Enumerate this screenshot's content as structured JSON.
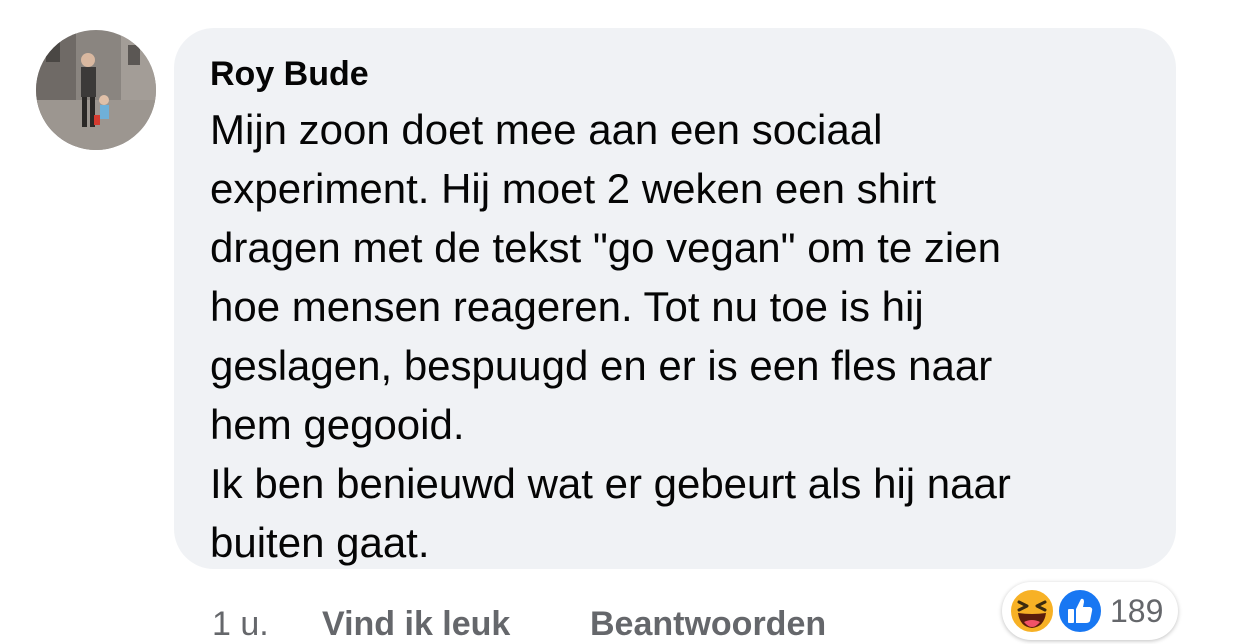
{
  "comment": {
    "author": "Roy Bude",
    "body_lines": [
      "Mijn zoon doet mee aan een sociaal",
      "experiment. Hij moet 2 weken een shirt",
      "dragen met de tekst \"go vegan\" om te zien",
      "hoe mensen reageren. Tot nu toe is hij",
      "geslagen, bespuugd en er is een fles naar",
      "hem gegooid.",
      "Ik ben benieuwd wat er gebeurt als hij naar",
      "buiten gaat."
    ]
  },
  "actions": {
    "time": "1 u.",
    "like_label": "Vind ik leuk",
    "reply_label": "Beantwoorden"
  },
  "reactions": {
    "icons": [
      "haha-icon",
      "like-icon"
    ],
    "count": "189"
  },
  "colors": {
    "bubble_bg": "#f0f2f5",
    "text": "#050505",
    "secondary_text": "#65676b",
    "like_blue": "#1877f2",
    "haha_yellow": "#f7b125"
  }
}
